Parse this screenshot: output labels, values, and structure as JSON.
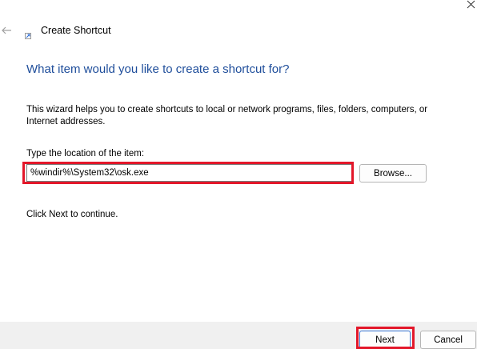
{
  "window": {
    "title": "Create Shortcut",
    "close_icon": "close-icon",
    "back_icon": "back-arrow-icon",
    "app_icon": "shortcut-icon"
  },
  "main": {
    "heading": "What item would you like to create a shortcut for?",
    "description": "This wizard helps you to create shortcuts to local or network programs, files, folders, computers, or Internet addresses.",
    "location_label": "Type the location of the item:",
    "location_value": "%windir%\\System32\\osk.exe",
    "browse_label": "Browse...",
    "continue_text": "Click Next to continue."
  },
  "footer": {
    "next_label": "Next",
    "cancel_label": "Cancel"
  },
  "colors": {
    "heading": "#1f4e9b",
    "highlight": "#e3172a",
    "footer_background": "#f0f0f0",
    "primary_button_border": "#3e7ad6"
  }
}
